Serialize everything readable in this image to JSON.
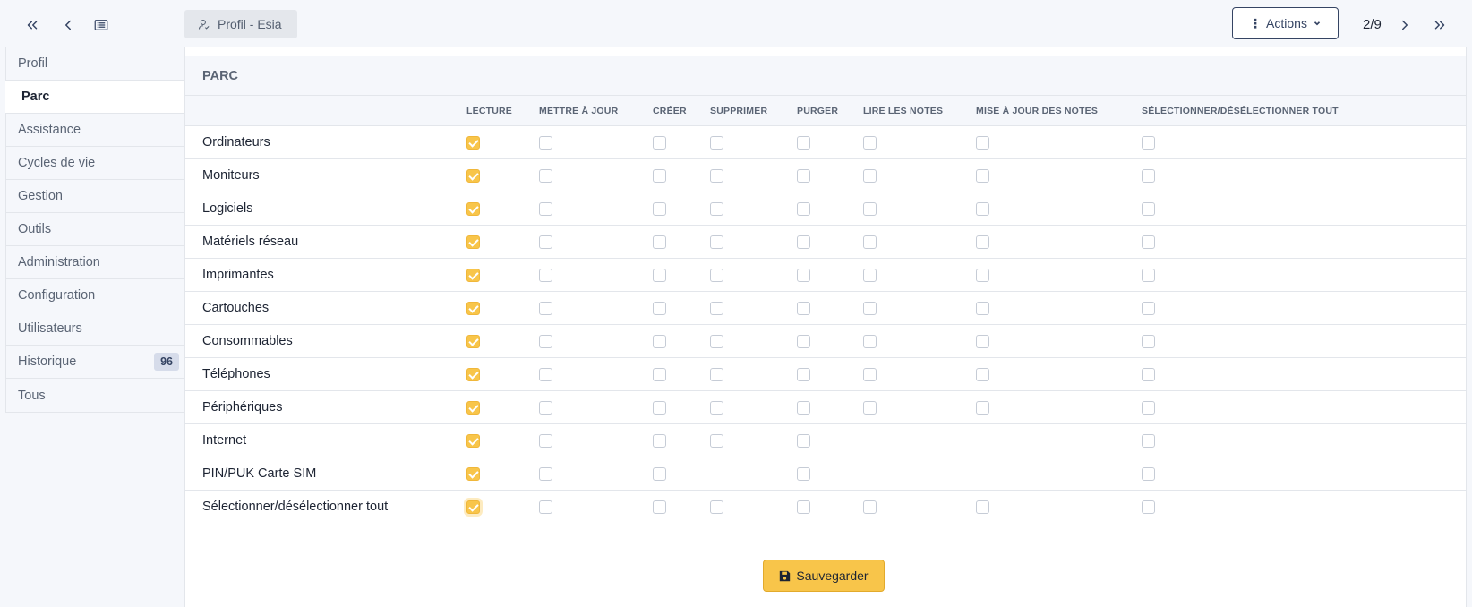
{
  "header": {
    "profile_chip": "Profil - Esia",
    "actions_label": "Actions",
    "pager": "2/9"
  },
  "sidebar": {
    "items": [
      {
        "label": "Profil",
        "badge": ""
      },
      {
        "label": "Parc",
        "badge": "",
        "active": true
      },
      {
        "label": "Assistance",
        "badge": ""
      },
      {
        "label": "Cycles de vie",
        "badge": ""
      },
      {
        "label": "Gestion",
        "badge": ""
      },
      {
        "label": "Outils",
        "badge": ""
      },
      {
        "label": "Administration",
        "badge": ""
      },
      {
        "label": "Configuration",
        "badge": ""
      },
      {
        "label": "Utilisateurs",
        "badge": ""
      },
      {
        "label": "Historique",
        "badge": "96"
      },
      {
        "label": "Tous",
        "badge": ""
      }
    ]
  },
  "section": {
    "title": "PARC",
    "columns": [
      "LECTURE",
      "METTRE À JOUR",
      "CRÉER",
      "SUPPRIMER",
      "PURGER",
      "LIRE LES NOTES",
      "MISE À JOUR DES NOTES",
      "SÉLECTIONNER/DÉSÉLECTIONNER TOUT"
    ],
    "rows": [
      {
        "label": "Ordinateurs",
        "cells": [
          1,
          0,
          0,
          0,
          0,
          0,
          0,
          0
        ]
      },
      {
        "label": "Moniteurs",
        "cells": [
          1,
          0,
          0,
          0,
          0,
          0,
          0,
          0
        ]
      },
      {
        "label": "Logiciels",
        "cells": [
          1,
          0,
          0,
          0,
          0,
          0,
          0,
          0
        ]
      },
      {
        "label": "Matériels réseau",
        "cells": [
          1,
          0,
          0,
          0,
          0,
          0,
          0,
          0
        ]
      },
      {
        "label": "Imprimantes",
        "cells": [
          1,
          0,
          0,
          0,
          0,
          0,
          0,
          0
        ]
      },
      {
        "label": "Cartouches",
        "cells": [
          1,
          0,
          0,
          0,
          0,
          0,
          0,
          0
        ]
      },
      {
        "label": "Consommables",
        "cells": [
          1,
          0,
          0,
          0,
          0,
          0,
          0,
          0
        ]
      },
      {
        "label": "Téléphones",
        "cells": [
          1,
          0,
          0,
          0,
          0,
          0,
          0,
          0
        ]
      },
      {
        "label": "Périphériques",
        "cells": [
          1,
          0,
          0,
          0,
          0,
          0,
          0,
          0
        ]
      },
      {
        "label": "Internet",
        "cells": [
          1,
          0,
          0,
          0,
          0,
          null,
          null,
          0
        ]
      },
      {
        "label": "PIN/PUK Carte SIM",
        "cells": [
          1,
          0,
          0,
          null,
          0,
          null,
          null,
          0
        ]
      },
      {
        "label": "Sélectionner/désélectionner tout",
        "cells": [
          1,
          0,
          0,
          0,
          0,
          0,
          0,
          0
        ]
      }
    ],
    "save_label": "Sauvegarder"
  },
  "icons": {
    "first": "double-chevron-left-icon",
    "prev": "chevron-left-icon",
    "list": "list-icon",
    "user": "user-icon",
    "kebab": "kebab-icon",
    "next": "chevron-right-icon",
    "last": "double-chevron-right-icon",
    "save": "floppy-disk-icon"
  },
  "colors": {
    "accent": "#f8c54a",
    "primary": "#354463"
  }
}
